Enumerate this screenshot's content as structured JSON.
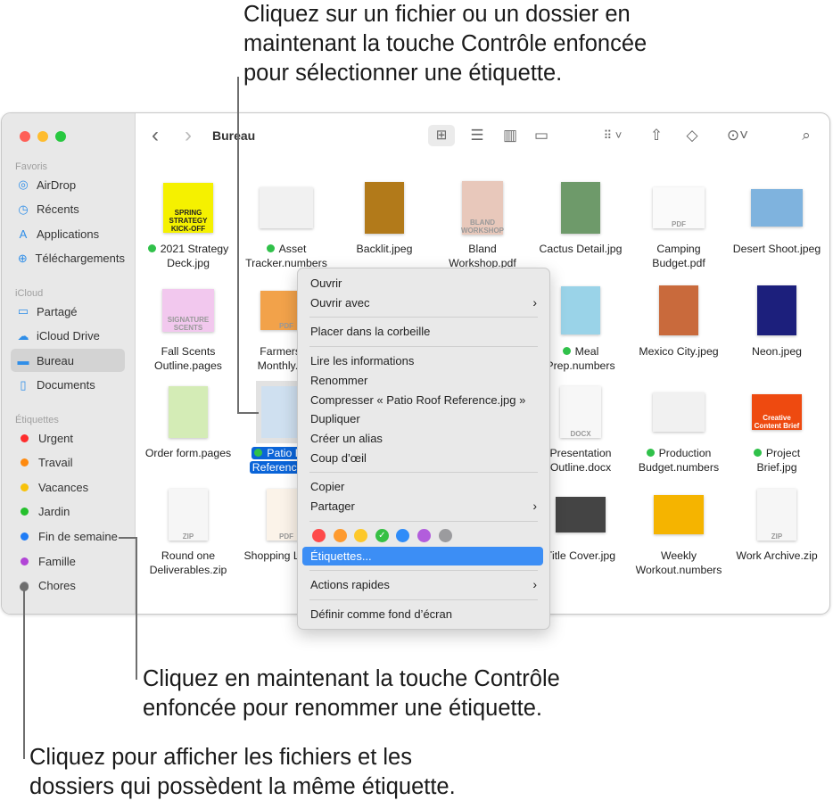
{
  "annotations": {
    "top": "Cliquez sur un fichier ou un dossier en\nmaintenant la touche Contrôle enfoncée\npour sélectionner une étiquette.",
    "middle": "Cliquez en maintenant la touche Contrôle\nenfoncée pour renommer une étiquette.",
    "bottom": "Cliquez pour afficher les fichiers et les\ndossiers qui possèdent la même étiquette."
  },
  "window": {
    "title": "Bureau",
    "traffic_lights": [
      "#fe5f57",
      "#febc2e",
      "#28c840"
    ]
  },
  "toolbar": {
    "back": "‹",
    "forward": "›",
    "icons": [
      "grid-view-icon",
      "list-view-icon",
      "column-view-icon",
      "gallery-view-icon",
      "group-icon",
      "share-icon",
      "tag-icon",
      "more-icon",
      "search-icon"
    ]
  },
  "sidebar": {
    "favoris_header": "Favoris",
    "favoris": [
      {
        "label": "AirDrop",
        "icon": "airdrop-icon",
        "glyph": "◎"
      },
      {
        "label": "Récents",
        "icon": "clock-icon",
        "glyph": "◷"
      },
      {
        "label": "Applications",
        "icon": "applications-icon",
        "glyph": "A"
      },
      {
        "label": "Téléchargements",
        "icon": "download-icon",
        "glyph": "⊕"
      }
    ],
    "icloud_header": "iCloud",
    "icloud": [
      {
        "label": "Partagé",
        "icon": "shared-folder-icon",
        "glyph": "▭"
      },
      {
        "label": "iCloud Drive",
        "icon": "cloud-icon",
        "glyph": "☁"
      },
      {
        "label": "Bureau",
        "icon": "desktop-icon",
        "glyph": "▬",
        "selected": true
      },
      {
        "label": "Documents",
        "icon": "document-icon",
        "glyph": "▯"
      }
    ],
    "tags_header": "Étiquettes",
    "tags": [
      {
        "label": "Urgent",
        "color": "#fe2d2d"
      },
      {
        "label": "Travail",
        "color": "#fe8a0f"
      },
      {
        "label": "Vacances",
        "color": "#f7c20b"
      },
      {
        "label": "Jardin",
        "color": "#25c02d"
      },
      {
        "label": "Fin de semaine",
        "color": "#1f7cf6"
      },
      {
        "label": "Famille",
        "color": "#b145d6"
      },
      {
        "label": "Chores",
        "color": "#8e8e93"
      }
    ]
  },
  "files": [
    {
      "l1": "2021 Strategy",
      "l2": "Deck.jpg",
      "tag": true,
      "thumb": "#f5f100",
      "tw": 56,
      "th": 56,
      "text": "SPRING STRATEGY KICK-OFF"
    },
    {
      "l1": "Asset",
      "l2": "Tracker.numbers",
      "tag": true,
      "thumb": "#f1f1f1",
      "tw": 60,
      "th": 46
    },
    {
      "l1": "Backlit.jpeg",
      "l2": "",
      "thumb": "#b27a1a",
      "tw": 44,
      "th": 58
    },
    {
      "l1": "Bland",
      "l2": "Workshop.pdf",
      "thumb": "#e8c8bb",
      "tw": 46,
      "th": 60,
      "text": "BLAND WORKSHOP"
    },
    {
      "l1": "Cactus Detail.jpg",
      "l2": "",
      "thumb": "#6e9a6a",
      "tw": 44,
      "th": 58
    },
    {
      "l1": "Camping",
      "l2": "Budget.pdf",
      "thumb": "#fafafa",
      "tw": 58,
      "th": 46,
      "text": "PDF"
    },
    {
      "l1": "Desert Shoot.jpeg",
      "l2": "",
      "thumb": "#7fb3de",
      "tw": 58,
      "th": 42
    },
    {
      "l1": "Fall Scents",
      "l2": "Outline.pages",
      "thumb": "#f2c8ee",
      "tw": 58,
      "th": 48,
      "text": "SIGNATURE SCENTS"
    },
    {
      "l1": "Farmers M",
      "l2": "Monthly...ck",
      "thumb": "#f2a24a",
      "tw": 58,
      "th": 44,
      "text": "PDF"
    },
    {
      "l1": "",
      "l2": ""
    },
    {
      "l1": "",
      "l2": ""
    },
    {
      "l1": "Meal",
      "l2": "Prep.numbers",
      "tag": true,
      "thumb": "#9ad3e8",
      "tw": 44,
      "th": 54
    },
    {
      "l1": "Mexico City.jpeg",
      "l2": "",
      "thumb": "#c96a3c",
      "tw": 44,
      "th": 56
    },
    {
      "l1": "Neon.jpeg",
      "l2": "",
      "thumb": "#1c1f7c",
      "tw": 44,
      "th": 56
    },
    {
      "l1": "Order form.pages",
      "l2": "",
      "thumb": "#d4ecb6",
      "tw": 44,
      "th": 58
    },
    {
      "l1": "Patio Roof",
      "l2": "Reference.jpg",
      "tag": true,
      "selected": true,
      "thumb": "#cfe0f0",
      "tw": 56,
      "th": 58
    },
    {
      "l1": "",
      "l2": ""
    },
    {
      "l1": "",
      "l2": ""
    },
    {
      "l1": "Presentation",
      "l2": "Outline.docx",
      "thumb": "#f7f7f7",
      "tw": 46,
      "th": 58,
      "text": "DOCX"
    },
    {
      "l1": "Production",
      "l2": "Budget.numbers",
      "tag": true,
      "thumb": "#f1f1f1",
      "tw": 58,
      "th": 44
    },
    {
      "l1": "Project",
      "l2": "Brief.jpg",
      "tag": true,
      "thumb": "#ee4a10",
      "tw": 56,
      "th": 40,
      "text": "Creative Content Brief"
    },
    {
      "l1": "Round one",
      "l2": "Deliverables.zip",
      "thumb": "#f6f6f6",
      "tw": 44,
      "th": 58,
      "text": "ZIP"
    },
    {
      "l1": "Shopping List.pdf",
      "l2": "",
      "thumb": "#fbf3e9",
      "tw": 44,
      "th": 58,
      "text": "PDF"
    },
    {
      "l1": "",
      "l2": ""
    },
    {
      "l1": "",
      "l2": ""
    },
    {
      "l1": "Title Cover.jpg",
      "l2": "",
      "thumb": "#444",
      "tw": 56,
      "th": 40
    },
    {
      "l1": "Weekly",
      "l2": "Workout.numbers",
      "thumb": "#f5b400",
      "tw": 56,
      "th": 44
    },
    {
      "l1": "Work Archive.zip",
      "l2": "",
      "thumb": "#f6f6f6",
      "tw": 44,
      "th": 58,
      "text": "ZIP"
    }
  ],
  "context_menu": {
    "items": [
      {
        "label": "Ouvrir"
      },
      {
        "label": "Ouvrir avec",
        "submenu": true
      },
      {
        "sep": true
      },
      {
        "label": "Placer dans la corbeille"
      },
      {
        "sep": true
      },
      {
        "label": "Lire les informations"
      },
      {
        "label": "Renommer"
      },
      {
        "label": "Compresser « Patio Roof Reference.jpg »"
      },
      {
        "label": "Dupliquer"
      },
      {
        "label": "Créer un alias"
      },
      {
        "label": "Coup d’œil"
      },
      {
        "sep": true
      },
      {
        "label": "Copier"
      },
      {
        "label": "Partager",
        "submenu": true
      },
      {
        "sep": true
      },
      {
        "tags": true
      },
      {
        "label": "Étiquettes...",
        "highlighted": true
      },
      {
        "sep": true
      },
      {
        "label": "Actions rapides",
        "submenu": true
      },
      {
        "sep": true
      },
      {
        "label": "Définir comme fond d’écran"
      }
    ],
    "tag_colors": [
      "#fe4a4a",
      "#fe9a2e",
      "#fdc82a",
      "#36c044",
      "#2f8cf8",
      "#b25ddc",
      "#9b9b9e"
    ],
    "checked_tag": 3
  }
}
